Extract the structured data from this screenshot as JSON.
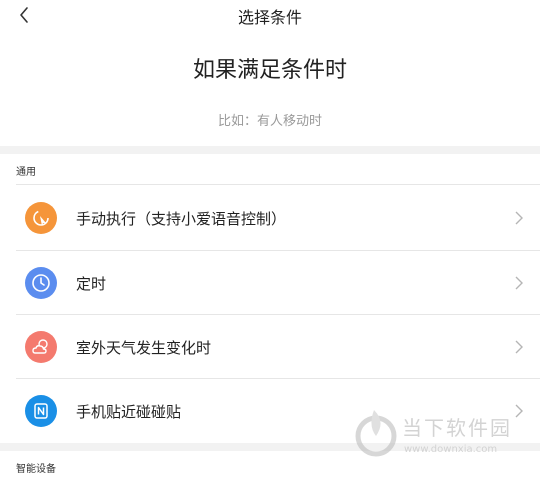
{
  "header": {
    "title": "选择条件"
  },
  "intro": {
    "title": "如果满足条件时",
    "hint": "比如：有人移动时"
  },
  "sections": [
    {
      "label": "通用",
      "items": [
        {
          "label": "手动执行（支持小爱语音控制）",
          "icon": "manual-tap-icon",
          "color": "#f5953a"
        },
        {
          "label": "定时",
          "icon": "clock-icon",
          "color": "#5b8def"
        },
        {
          "label": "室外天气发生变化时",
          "icon": "weather-icon",
          "color": "#f47a6e"
        },
        {
          "label": "手机贴近碰碰贴",
          "icon": "nfc-icon",
          "color": "#1a8fe6"
        }
      ]
    },
    {
      "label": "智能设备"
    }
  ],
  "watermark": {
    "text": "当下软件园",
    "url": "www.downxia.com"
  }
}
